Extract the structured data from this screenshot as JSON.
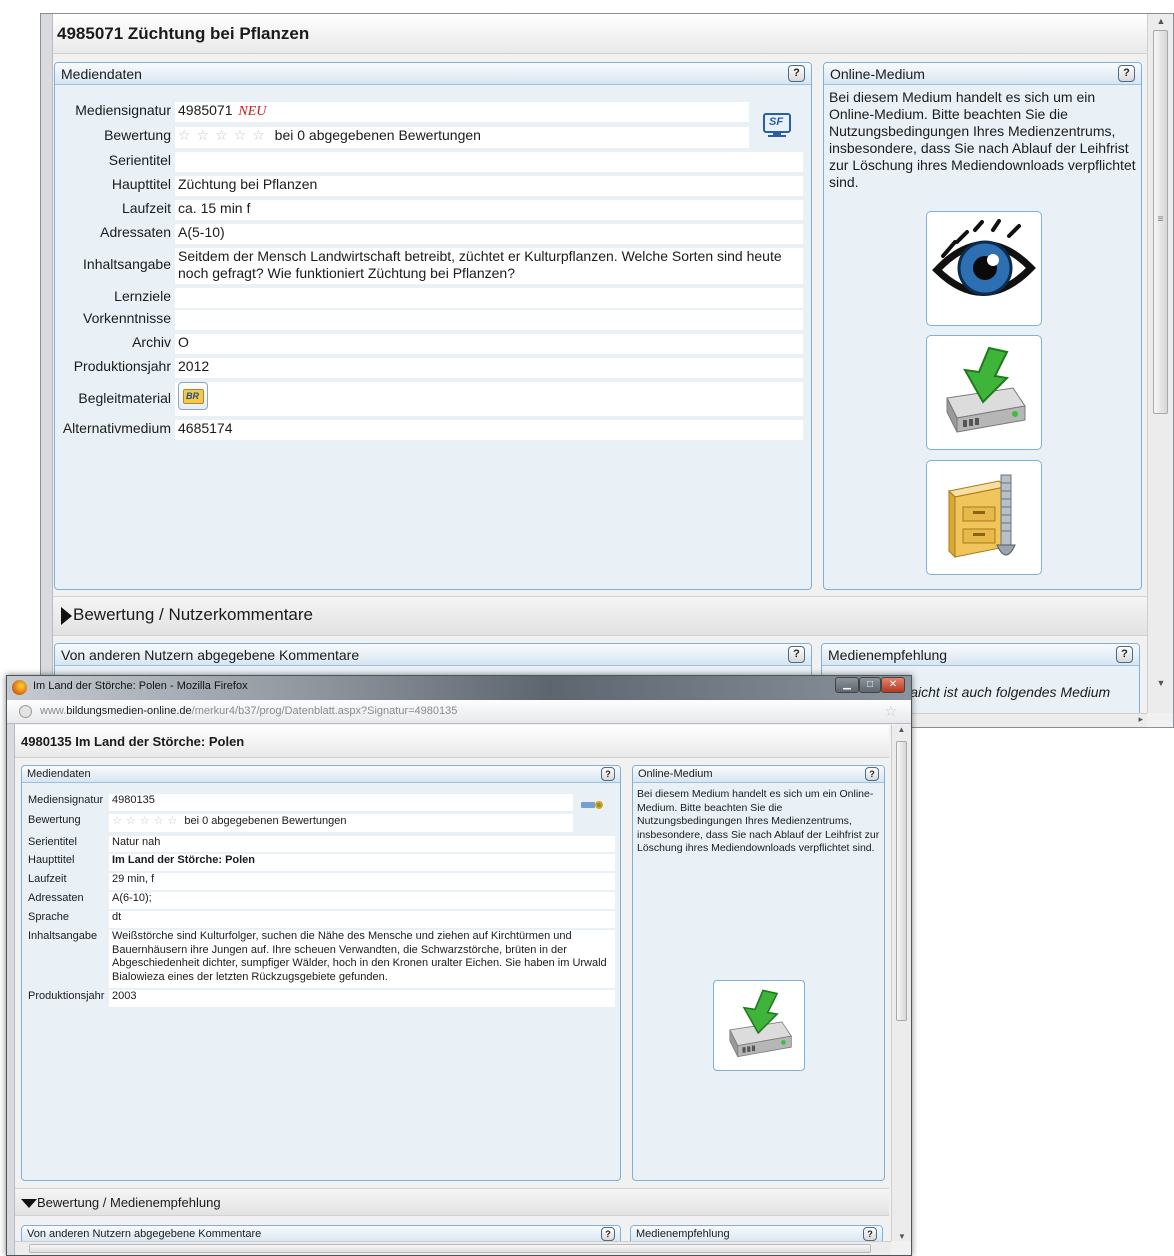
{
  "back_window": {
    "title": "4985071 Züchtung bei Pflanzen",
    "mediendaten": {
      "header": "Mediendaten",
      "help": "?",
      "fields": [
        {
          "label": "Mediensignatur",
          "value": "4985071",
          "badge": "NEU"
        },
        {
          "label": "Bewertung",
          "stars": "☆☆☆☆☆",
          "value": "bei 0 abgegebenen Bewertungen"
        },
        {
          "label": "Serientitel",
          "value": ""
        },
        {
          "label": "Haupttitel",
          "value": "Züchtung bei Pflanzen"
        },
        {
          "label": "Laufzeit",
          "value": "ca. 15 min f"
        },
        {
          "label": "Adressaten",
          "value": "A(5-10)"
        },
        {
          "label": "Inhaltsangabe",
          "value": "Seitdem der Mensch Landwirtschaft betreibt, züchtet er Kulturpflanzen. Welche Sorten sind heute noch gefragt? Wie funktioniert Züchtung bei Pflanzen?"
        },
        {
          "label": "Lernziele",
          "value": ""
        },
        {
          "label": "Vorkenntnisse",
          "value": ""
        },
        {
          "label": "Archiv",
          "value": "O"
        },
        {
          "label": "Produktionsjahr",
          "value": "2012"
        },
        {
          "label": "Begleitmaterial",
          "value": ""
        },
        {
          "label": "Alternativmedium",
          "value": "4685174"
        }
      ],
      "sf_icon_text": "SF",
      "br_icon_text": "BR"
    },
    "online_medium": {
      "header": "Online-Medium",
      "help": "?",
      "text": "Bei diesem Medium handelt es sich um ein Online-Medium. Bitte beachten Sie die Nutzungsbedingungen Ihres Medienzentrums, insbesondere, dass Sie nach Ablauf der Leihfrist zur Löschung ihres Mediendownloads verpflichtet sind."
    },
    "accordion_label": "Bewertung / Nutzerkommentare",
    "comments_header": "Von anderen Nutzern abgegebene Kommentare",
    "recommendation_header": "Medienempfehlung",
    "recommendation_partial": "llaicht ist auch folgendes Medium"
  },
  "front_window": {
    "window_title": "Im Land der Störche: Polen - Mozilla Firefox",
    "url_prefix": "www.",
    "url_domain": "bildungsmedien-online.de",
    "url_path": "/merkur4/b37/prog/Datenblatt.aspx?Signatur=4980135",
    "title": "4980135 Im Land der Störche: Polen",
    "mediendaten": {
      "header": "Mediendaten",
      "help": "?",
      "fields": [
        {
          "label": "Mediensignatur",
          "value": "4980135"
        },
        {
          "label": "Bewertung",
          "stars": "☆☆☆☆☆",
          "value": "bei 0 abgegebenen Bewertungen"
        },
        {
          "label": "Serientitel",
          "value": "Natur nah"
        },
        {
          "label": "Haupttitel",
          "value": "Im Land der Störche: Polen"
        },
        {
          "label": "Laufzeit",
          "value": "29 min, f"
        },
        {
          "label": "Adressaten",
          "value": "A(6-10);"
        },
        {
          "label": "Sprache",
          "value": "dt"
        },
        {
          "label": "Inhaltsangabe",
          "value": "Weißstörche sind Kulturfolger, suchen die Nähe des Mensche und ziehen auf Kirchtürmen und Bauernhäusern ihre Jungen auf. Ihre scheuen Verwandten, die Schwarzstörche, brüten in der Abgeschiedenheit dichter, sumpfiger Wälder, hoch in den Kronen uralter Eichen. Sie haben im Urwald Bialowieza eines der letzten Rückzugsgebiete gefunden."
        },
        {
          "label": "Produktionsjahr",
          "value": "2003"
        }
      ]
    },
    "online_medium": {
      "header": "Online-Medium",
      "help": "?",
      "text": "Bei diesem Medium handelt es sich um ein Online-Medium. Bitte beachten Sie die Nutzungsbedingungen Ihres Medienzentrums, insbesondere, dass Sie nach Ablauf der Leihfrist zur Löschung ihres Mediendownloads verpflichtet sind."
    },
    "accordion_label": "Bewertung / Medienempfehlung",
    "comments_header": "Von anderen Nutzern abgegebene Kommentare",
    "recommendation_header": "Medienempfehlung"
  },
  "icons": [
    "firefox-icon",
    "eye-icon",
    "download-drive-icon",
    "archive-zip-icon",
    "sf-icon",
    "br-folder-icon",
    "help-icon"
  ],
  "colors": {
    "accent_border": "#7fb1d8",
    "panel_bg": "#e9f1f7",
    "neu_badge": "#d11818"
  }
}
